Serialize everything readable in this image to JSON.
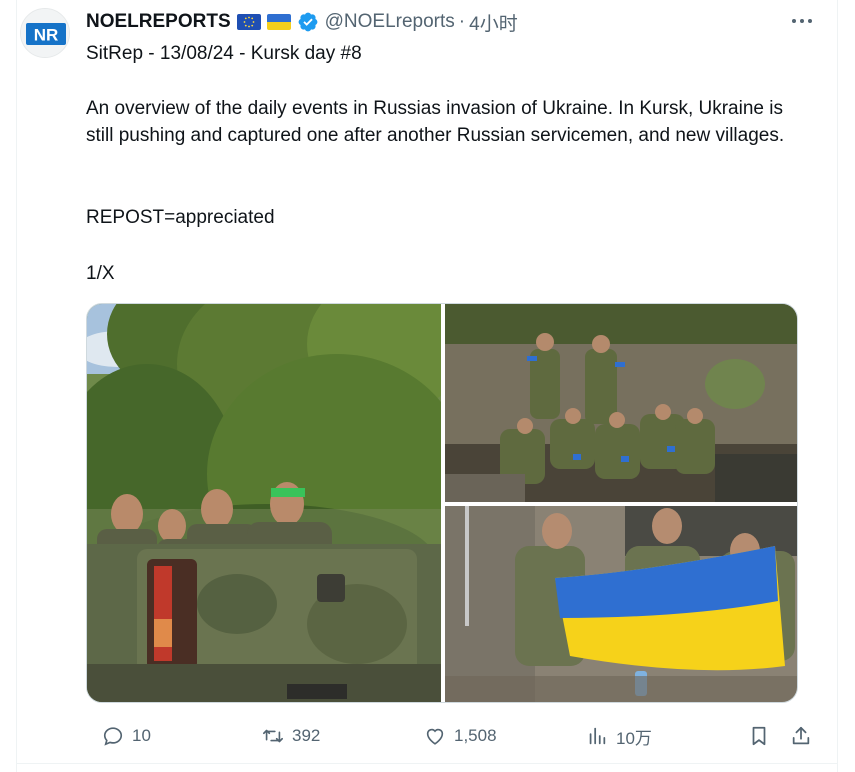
{
  "author": {
    "display_name": "NOELREPORTS",
    "handle": "@NOELreports",
    "separator": "·",
    "time": "4小时",
    "avatar_text": "NR",
    "verified": true,
    "flags": [
      "eu-flag",
      "ukraine-flag"
    ]
  },
  "post": {
    "title": "SitRep - 13/08/24 - Kursk day #8",
    "body": "An overview of the daily events in Russias invasion of Ukraine. In Kursk, Ukraine is still pushing and captured one after another Russian servicemen, and new villages.",
    "repost_line": "REPOST=appreciated",
    "thread_count": "1/X"
  },
  "media": {
    "images": [
      {
        "name": "photo-prisoners-truck"
      },
      {
        "name": "photo-prisoners-trench"
      },
      {
        "name": "photo-prisoners-flag"
      }
    ]
  },
  "actions": {
    "replies": "10",
    "reposts": "392",
    "likes": "1,508",
    "views": "10万"
  },
  "colors": {
    "text_primary": "#0f1419",
    "text_secondary": "#536471",
    "verified_blue": "#1d9bf0",
    "border": "#cfd9de",
    "avatar_blue": "#1673c8"
  },
  "icons": {
    "more": "more-dots-icon",
    "reply": "reply-icon",
    "repost": "repost-icon",
    "like": "heart-icon",
    "views": "views-chart-icon",
    "bookmark": "bookmark-icon",
    "share": "share-icon"
  }
}
